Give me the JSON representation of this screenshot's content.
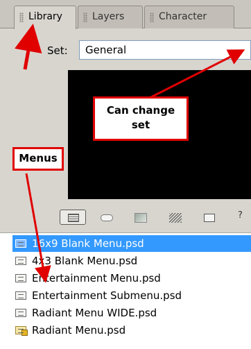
{
  "tabs": [
    {
      "label": "Library",
      "active": true
    },
    {
      "label": "Layers",
      "active": false
    },
    {
      "label": "Character",
      "active": false
    }
  ],
  "set": {
    "label": "Set:",
    "value": "General"
  },
  "toolbar": {
    "icons": [
      "list-view-icon",
      "oval-shape-icon",
      "picture-icon",
      "stripe-pattern-icon",
      "folder-box-icon"
    ],
    "more_glyph": "?"
  },
  "files": [
    {
      "name": "16x9 Blank Menu.psd",
      "selected": true,
      "icon": "menu-file-icon"
    },
    {
      "name": "4x3 Blank Menu.psd",
      "selected": false,
      "icon": "menu-file-icon"
    },
    {
      "name": "Entertainment Menu.psd",
      "selected": false,
      "icon": "menu-file-icon"
    },
    {
      "name": "Entertainment Submenu.psd",
      "selected": false,
      "icon": "menu-file-icon"
    },
    {
      "name": "Radiant Menu WIDE.psd",
      "selected": false,
      "icon": "menu-file-icon"
    },
    {
      "name": "Radiant Menu.psd",
      "selected": false,
      "icon": "menu-file-special-icon"
    }
  ],
  "annotations": {
    "set_callout_line1": "Can change",
    "set_callout_line2": "set",
    "menus_callout": "Menus",
    "arrow_color": "#e00000"
  },
  "colors": {
    "panel_bg": "#d8d5cf",
    "selection": "#3399ff",
    "preview_bg": "#000000"
  }
}
